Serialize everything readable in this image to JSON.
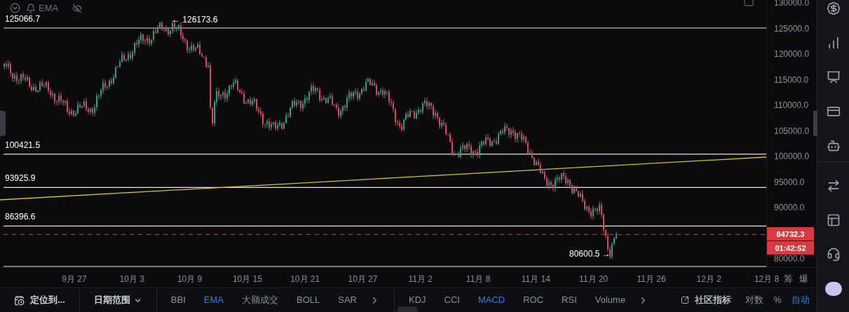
{
  "top_legend": {
    "indicator": "EMA"
  },
  "price_lines": [
    {
      "label": "125066.7"
    },
    {
      "label": "100421.5"
    },
    {
      "label": "93925.9"
    },
    {
      "label": "86396.6"
    }
  ],
  "annotations": [
    {
      "kind": "high",
      "label": "← 126173.6"
    },
    {
      "kind": "low",
      "label": "80600.5 →"
    }
  ],
  "price_axis": [
    "130000.0",
    "125000.0",
    "120000.0",
    "115000.0",
    "110000.0",
    "105000.0",
    "100000.0",
    "95000.0",
    "90000.0",
    "80000.0"
  ],
  "last_price": "84732.3",
  "countdown": "01:42:52",
  "time_axis": [
    "9月 27",
    "10月 3",
    "10月 9",
    "10月 15",
    "10月 21",
    "10月 27",
    "11月 2",
    "11月 8",
    "11月 14",
    "11月 20",
    "11月 26",
    "12月 2",
    "12月 8"
  ],
  "axis_buttons": [
    "筹",
    "爆"
  ],
  "bottom_toolbar": {
    "locate": "定位到...",
    "date_range": "日期范围",
    "main_indicators": [
      {
        "label": "BBI",
        "selected": false
      },
      {
        "label": "EMA",
        "selected": true
      },
      {
        "label": "大额成交",
        "selected": false
      },
      {
        "label": "BOLL",
        "selected": false
      },
      {
        "label": "SAR",
        "selected": false
      }
    ],
    "sub_indicators": [
      {
        "label": "KDJ",
        "selected": false
      },
      {
        "label": "CCI",
        "selected": false
      },
      {
        "label": "MACD",
        "selected": true
      },
      {
        "label": "ROC",
        "selected": false
      },
      {
        "label": "RSI",
        "selected": false
      },
      {
        "label": "Volume",
        "selected": false
      }
    ],
    "community": "社区指标",
    "scale_options": [
      {
        "label": "对数",
        "selected": false
      },
      {
        "label": "%",
        "selected": false
      },
      {
        "label": "自动",
        "selected": true
      }
    ]
  }
}
